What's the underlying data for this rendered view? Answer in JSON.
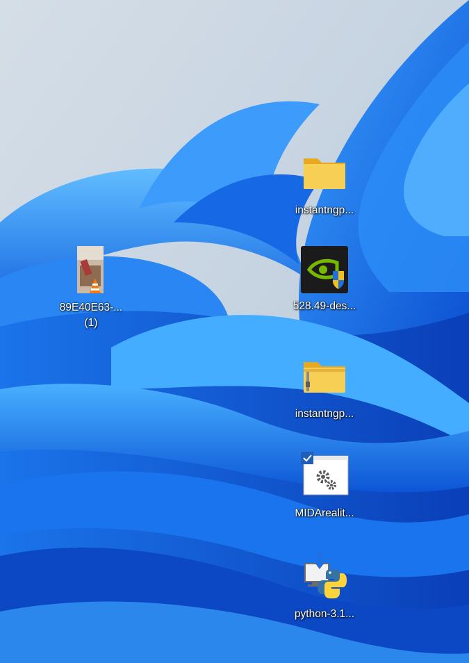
{
  "desktop": {
    "icons": [
      {
        "label": "instantngp...",
        "icon": "folder-icon"
      },
      {
        "label": "528.49-des...",
        "icon": "nvidia-installer-icon"
      },
      {
        "label": "instantngp...",
        "icon": "zip-folder-icon"
      },
      {
        "label": "MIDArealit...",
        "icon": "settings-app-icon"
      },
      {
        "label": "python-3.1...",
        "icon": "python-installer-icon"
      },
      {
        "label": "89E40E63-...",
        "label2": "(1)",
        "icon": "video-file-icon"
      }
    ]
  },
  "colors": {
    "folder": "#f6c94c",
    "nvidia_green": "#76b900",
    "wallpaper_blue": "#1a6fe8",
    "wallpaper_sky": "#c6d4e2"
  }
}
